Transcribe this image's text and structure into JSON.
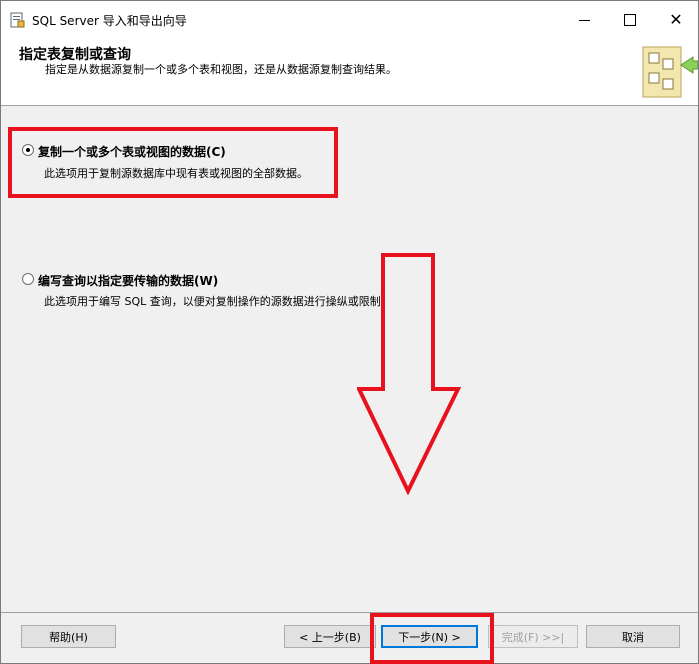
{
  "window": {
    "title": "SQL Server 导入和导出向导",
    "icon": "sql-wizard-icon"
  },
  "header": {
    "title": "指定表复制或查询",
    "subtitle": "指定是从数据源复制一个或多个表和视图，还是从数据源复制查询结果。",
    "graphic_icon": "wizard-header-graphic"
  },
  "options": [
    {
      "label": "复制一个或多个表或视图的数据(C)",
      "description": "此选项用于复制源数据库中现有表或视图的全部数据。",
      "selected": true
    },
    {
      "label": "编写查询以指定要传输的数据(W)",
      "description": "此选项用于编写 SQL 查询，以便对复制操作的源数据进行操纵或限制。",
      "selected": false
    }
  ],
  "buttons": {
    "help": "帮助(H)",
    "back": "< 上一步(B)",
    "next": "下一步(N) >",
    "finish": "完成(F) >>|",
    "cancel": "取消"
  },
  "colors": {
    "annotation_red": "#e8121f",
    "accent_blue": "#0078d7"
  }
}
